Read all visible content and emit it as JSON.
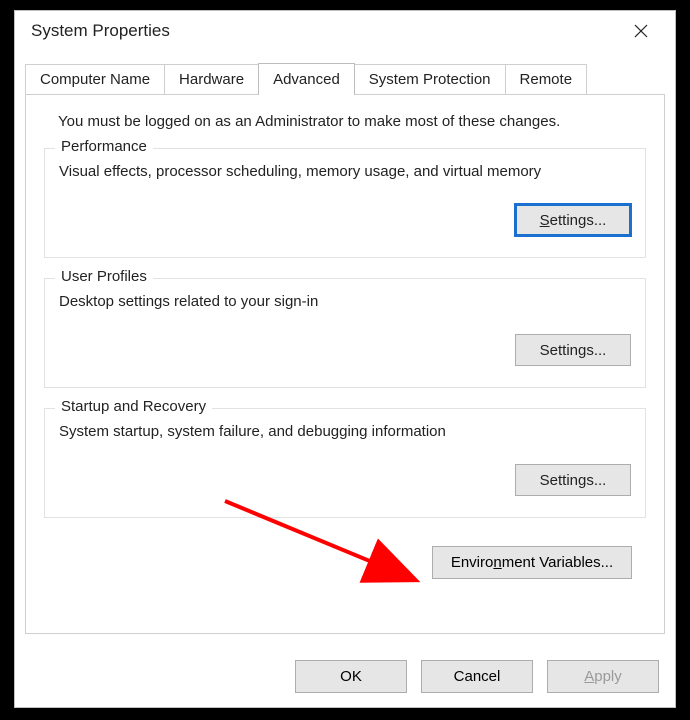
{
  "window": {
    "title": "System Properties"
  },
  "tabs": {
    "items": [
      {
        "label": "Computer Name",
        "active": false
      },
      {
        "label": "Hardware",
        "active": false
      },
      {
        "label": "Advanced",
        "active": true
      },
      {
        "label": "System Protection",
        "active": false
      },
      {
        "label": "Remote",
        "active": false
      }
    ]
  },
  "advanced": {
    "intro": "You must be logged on as an Administrator to make most of these changes.",
    "performance": {
      "legend": "Performance",
      "desc": "Visual effects, processor scheduling, memory usage, and virtual memory",
      "btn_prefix": "S",
      "btn_rest": "ettings..."
    },
    "user_profiles": {
      "legend": "User Profiles",
      "desc": "Desktop settings related to your sign-in",
      "btn_prefix": "S",
      "btn_rest": "ettings..."
    },
    "startup": {
      "legend": "Startup and Recovery",
      "desc": "System startup, system failure, and debugging information",
      "btn_prefix": "S",
      "btn_rest": "ettings..."
    },
    "env_btn_prefix": "Enviro",
    "env_btn_hot": "n",
    "env_btn_rest": "ment Variables..."
  },
  "buttons": {
    "ok": "OK",
    "cancel": "Cancel",
    "apply_hot": "A",
    "apply_rest": "pply"
  }
}
